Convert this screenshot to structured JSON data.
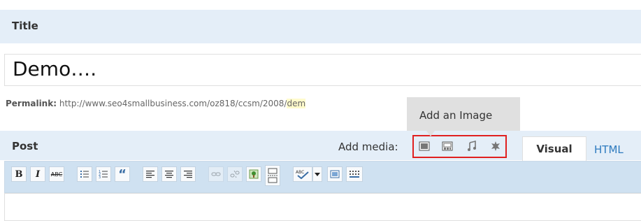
{
  "title_section": {
    "label": "Title",
    "value": "Demo…."
  },
  "permalink": {
    "label": "Permalink:",
    "url_prefix": "http://www.seo4smallbusiness.com/oz818/ccsm/2008/",
    "slug": "dem"
  },
  "tooltip": {
    "text": "Add an Image"
  },
  "post_section": {
    "label": "Post"
  },
  "media": {
    "label": "Add media:",
    "icons": [
      "add-image-icon",
      "add-video-icon",
      "add-audio-icon",
      "add-media-icon"
    ]
  },
  "tabs": {
    "visual": "Visual",
    "html": "HTML"
  },
  "toolbar": {
    "bold": "B",
    "italic": "I",
    "strikethrough": "ABC",
    "blockquote": "“",
    "buttons": [
      "bold",
      "italic",
      "strikethrough",
      "unordered-list",
      "ordered-list",
      "blockquote",
      "align-left",
      "align-center",
      "align-right",
      "insert-link",
      "unlink",
      "insert-image",
      "insert-more",
      "spellcheck",
      "spellcheck-dropdown",
      "fullscreen",
      "kitchen-sink"
    ]
  },
  "colors": {
    "header_bg": "#e4eef8",
    "toolbar_bg": "#cfe1f1",
    "highlight": "#e02020",
    "link": "#2e7bbf"
  }
}
